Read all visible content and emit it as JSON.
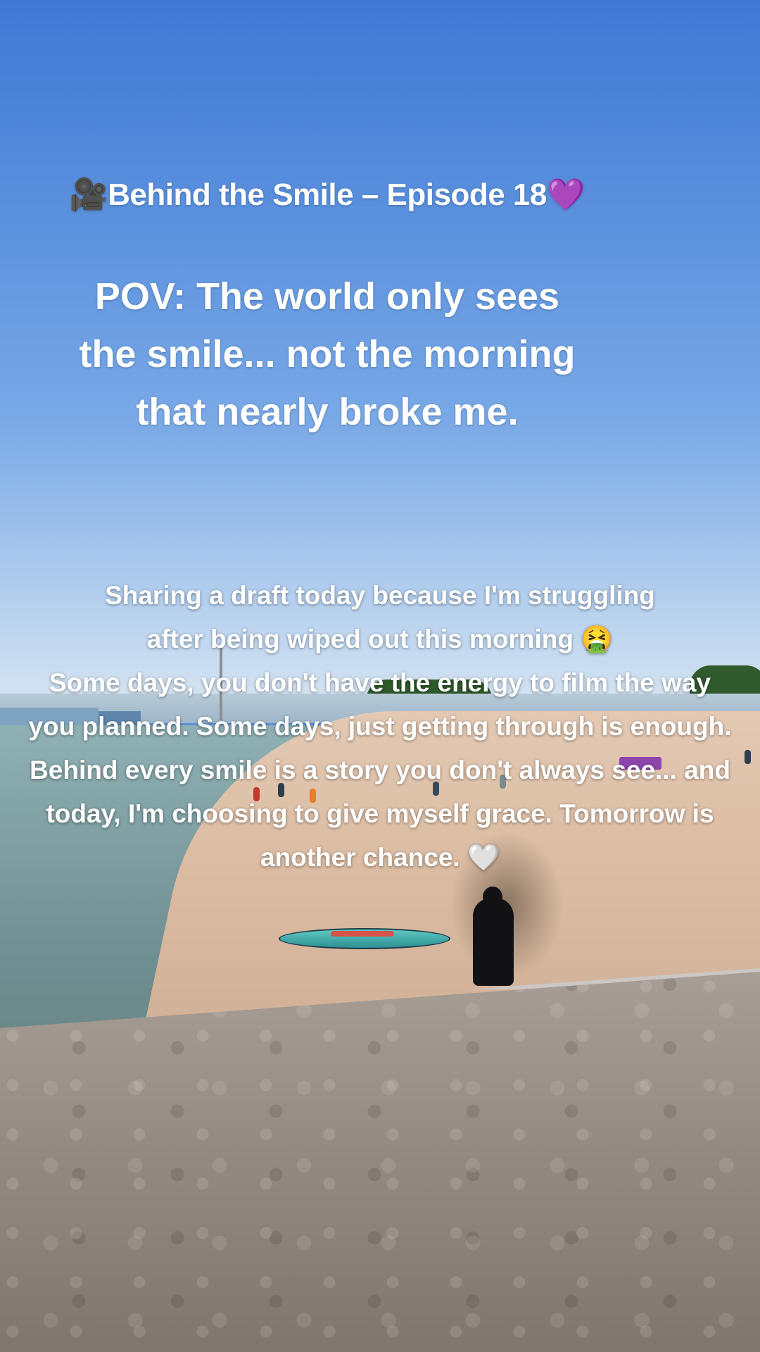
{
  "episode_title": "🎥Behind the Smile – Episode 18💜",
  "pov_lines": [
    "POV: The world only sees",
    "the smile... not the morning",
    "that nearly broke me."
  ],
  "caption_lines": [
    "Sharing a draft today because I'm struggling",
    "after being wiped out this morning 🤮",
    "Some days, you don't have the energy to film the way",
    "you planned. Some days, just getting through is enough.",
    "Behind every smile is a story you don't always see... and",
    "today, I'm choosing to give myself grace. Tomorrow is",
    "another chance. 🤍"
  ],
  "colors": {
    "sky": "#4f86d8",
    "text": "#ffffff",
    "sand": "#dcbda4",
    "water": "#7f9fa2"
  }
}
